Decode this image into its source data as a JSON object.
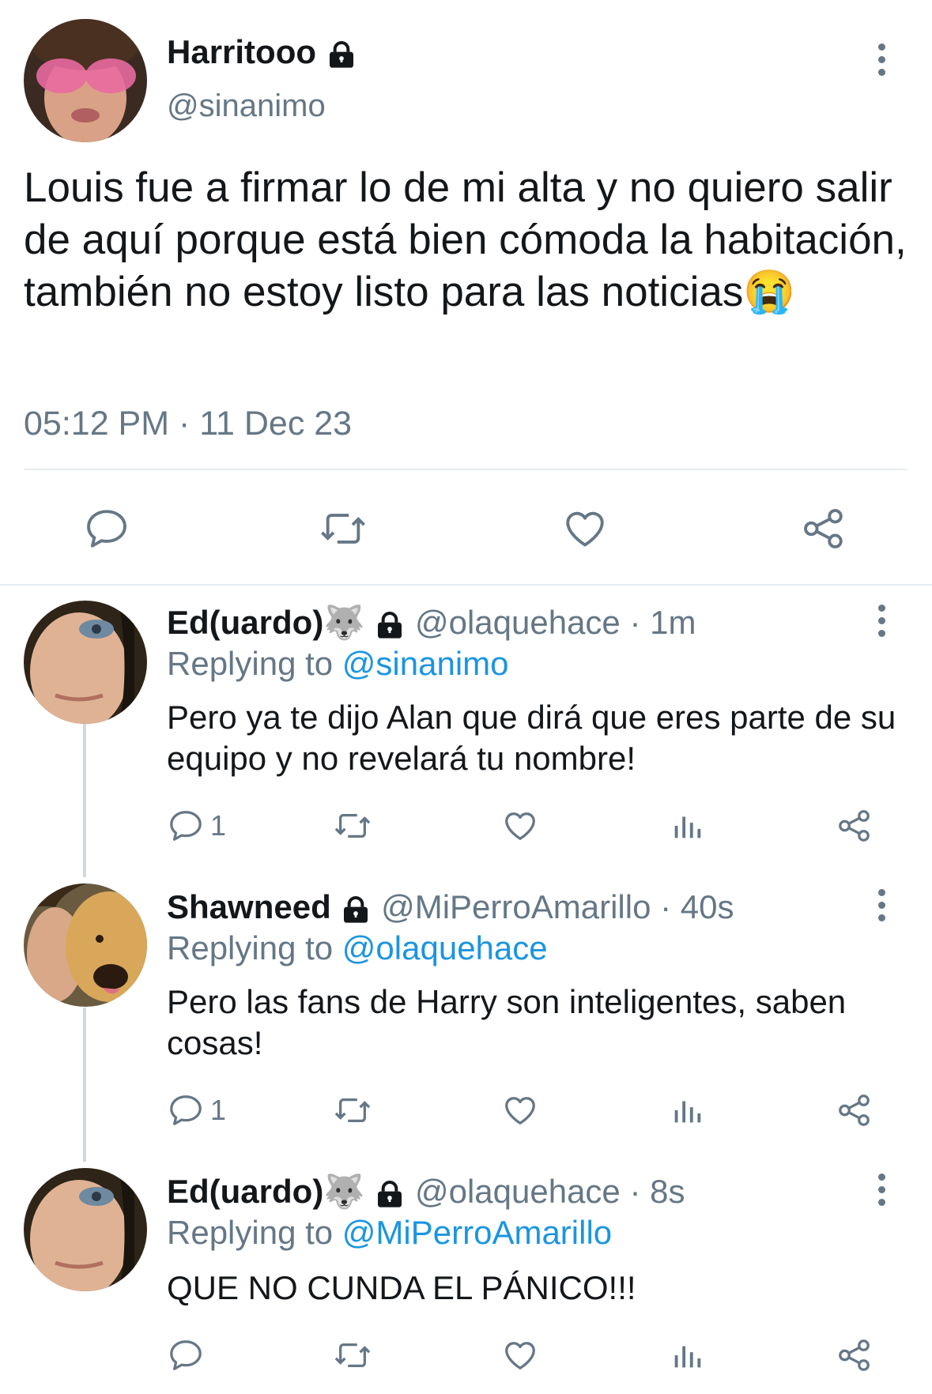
{
  "main_tweet": {
    "display_name": "Harritooo",
    "handle": "@sinanimo",
    "text": "Louis fue a firmar lo de mi alta y no quiero salir de aquí porque está bien cómoda la habitación, también no estoy listo para las noticias",
    "emoji": "😭",
    "timestamp": "05:12 PM · 11 Dec 23",
    "avatar_icon": "avatar-pink-glasses"
  },
  "replies": [
    {
      "display_name": "Ed(uardo)",
      "name_emoji": "🐺",
      "handle": "@olaquehace",
      "time": " · 1m",
      "replying_label": "Replying to ",
      "replying_to": "@sinanimo",
      "text": "Pero ya te dijo Alan que dirá que eres parte de su equipo y no revelará tu nombre!",
      "reply_count": "1"
    },
    {
      "display_name": "Shawneed",
      "handle": "@MiPerroAmarillo",
      "time": " · 40s",
      "replying_label": "Replying to ",
      "replying_to": "@olaquehace",
      "text": "Pero las fans de Harry son inteligentes, saben cosas!",
      "reply_count": "1"
    },
    {
      "display_name": "Ed(uardo)",
      "name_emoji": "🐺",
      "handle": "@olaquehace",
      "time": " · 8s",
      "replying_label": "Replying to ",
      "replying_to": "@MiPerroAmarillo",
      "text": "QUE NO CUNDA EL PÁNICO!!!",
      "reply_count": ""
    }
  ],
  "colors": {
    "text": "#14171a",
    "secondary": "#657786",
    "link": "#1b95e0",
    "divider": "#e6ecf0"
  }
}
